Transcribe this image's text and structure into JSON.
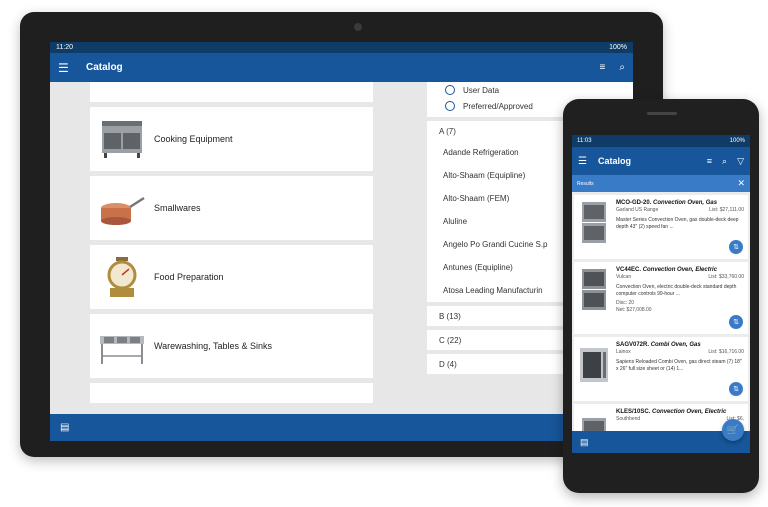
{
  "tablet": {
    "status": {
      "time": "11:20",
      "battery": "100%"
    },
    "appbar": {
      "title": "Catalog",
      "menu_icon": "menu-icon",
      "sort_icon": "sort-icon",
      "search_icon": "search-icon"
    },
    "categories": [
      {
        "label": "Cooking Equipment",
        "icon": "range-oven"
      },
      {
        "label": "Smallwares",
        "icon": "saucepan"
      },
      {
        "label": "Food Preparation",
        "icon": "food-scale"
      },
      {
        "label": "Warewashing, Tables & Sinks",
        "icon": "sink"
      }
    ],
    "filters": {
      "options": [
        "User Data",
        "Preferred/Approved"
      ],
      "groups": [
        {
          "heading": "A (7)",
          "items": [
            "Adande Refrigeration",
            "Alto-Shaam (Equipline)",
            "Alto-Shaam (FEM)",
            "Aluline",
            "Angelo Po Grandi Cucine S.p",
            "Antunes (Equipline)",
            "Atosa Leading Manufacturin"
          ]
        },
        {
          "heading": "B (13)",
          "items": []
        },
        {
          "heading": "C (22)",
          "items": []
        },
        {
          "heading": "D (4)",
          "items": []
        }
      ]
    }
  },
  "phone": {
    "status": {
      "time": "11:03",
      "battery": "100%"
    },
    "appbar": {
      "title": "Catalog"
    },
    "results_label": "Results",
    "products": [
      {
        "model": "MCO-GD-20.",
        "name": "Convection Oven, Gas",
        "brand": "Garland US Range",
        "list": "List: $27,111.00",
        "desc": "Master Series Convection Oven, gas double-deck deep depth 43\" (2) speed fan ..."
      },
      {
        "model": "VC44EC.",
        "name": "Convection Oven, Electric",
        "brand": "Vulcan",
        "list": "List: $33,760.00",
        "desc": "Convection Oven, electric double-deck standard depth computer controls 99-hour ...",
        "disc": "Disc: 20",
        "net": "Net: $27,008.00"
      },
      {
        "model": "SAGV072R.",
        "name": "Combi Oven, Gas",
        "brand": "Lainox",
        "list": "List: $16,716.00",
        "desc": "Sapiens Reloaded Combi Oven, gas direct steam (7) 18\" x 26\" full size sheet or (14) 1..."
      },
      {
        "model": "KLES/10SC.",
        "name": "Convection Oven, Electric",
        "brand": "Southbend",
        "list": "List: $6,",
        "desc": ""
      }
    ]
  }
}
